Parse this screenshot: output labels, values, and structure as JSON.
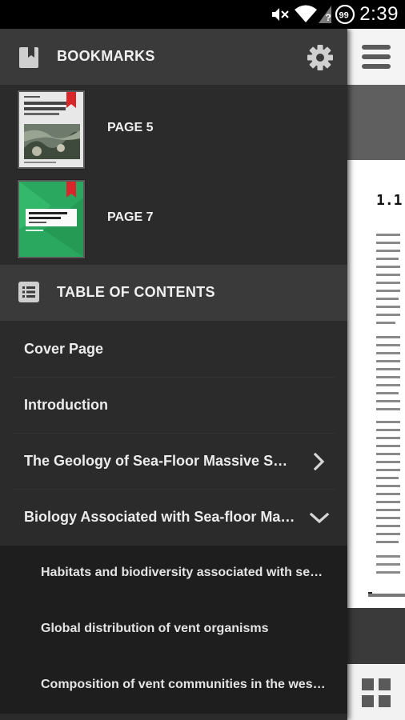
{
  "status_bar": {
    "time": "2:39",
    "battery_level": "99",
    "icons": [
      "mute-icon",
      "wifi-icon",
      "signal-icon",
      "battery-icon"
    ]
  },
  "drawer": {
    "bookmarks": {
      "title": "BOOKMARKS",
      "items": [
        {
          "label": "PAGE 5"
        },
        {
          "label": "PAGE 7"
        }
      ]
    },
    "toc": {
      "title": "TABLE OF CONTENTS",
      "items": [
        {
          "label": "Cover Page"
        },
        {
          "label": "Introduction"
        },
        {
          "label": "The Geology of Sea-Floor Massive Sulphides",
          "chevron": "right"
        },
        {
          "label": "Biology Associated with Sea-floor Massive...",
          "chevron": "down"
        }
      ],
      "subitems": [
        {
          "label": "Habitats and biodiversity associated with sea-floor..."
        },
        {
          "label": "Global distribution of vent organisms"
        },
        {
          "label": "Composition of vent communities in the western..."
        }
      ]
    }
  },
  "document": {
    "heading": "1.1"
  },
  "colors": {
    "drawer_bg": "#2b2b2b",
    "header_bg": "#3a3a3a",
    "subitem_bg": "#1e1e1e",
    "bookmark_ribbon": "#d8262a",
    "text": "#ececec"
  }
}
